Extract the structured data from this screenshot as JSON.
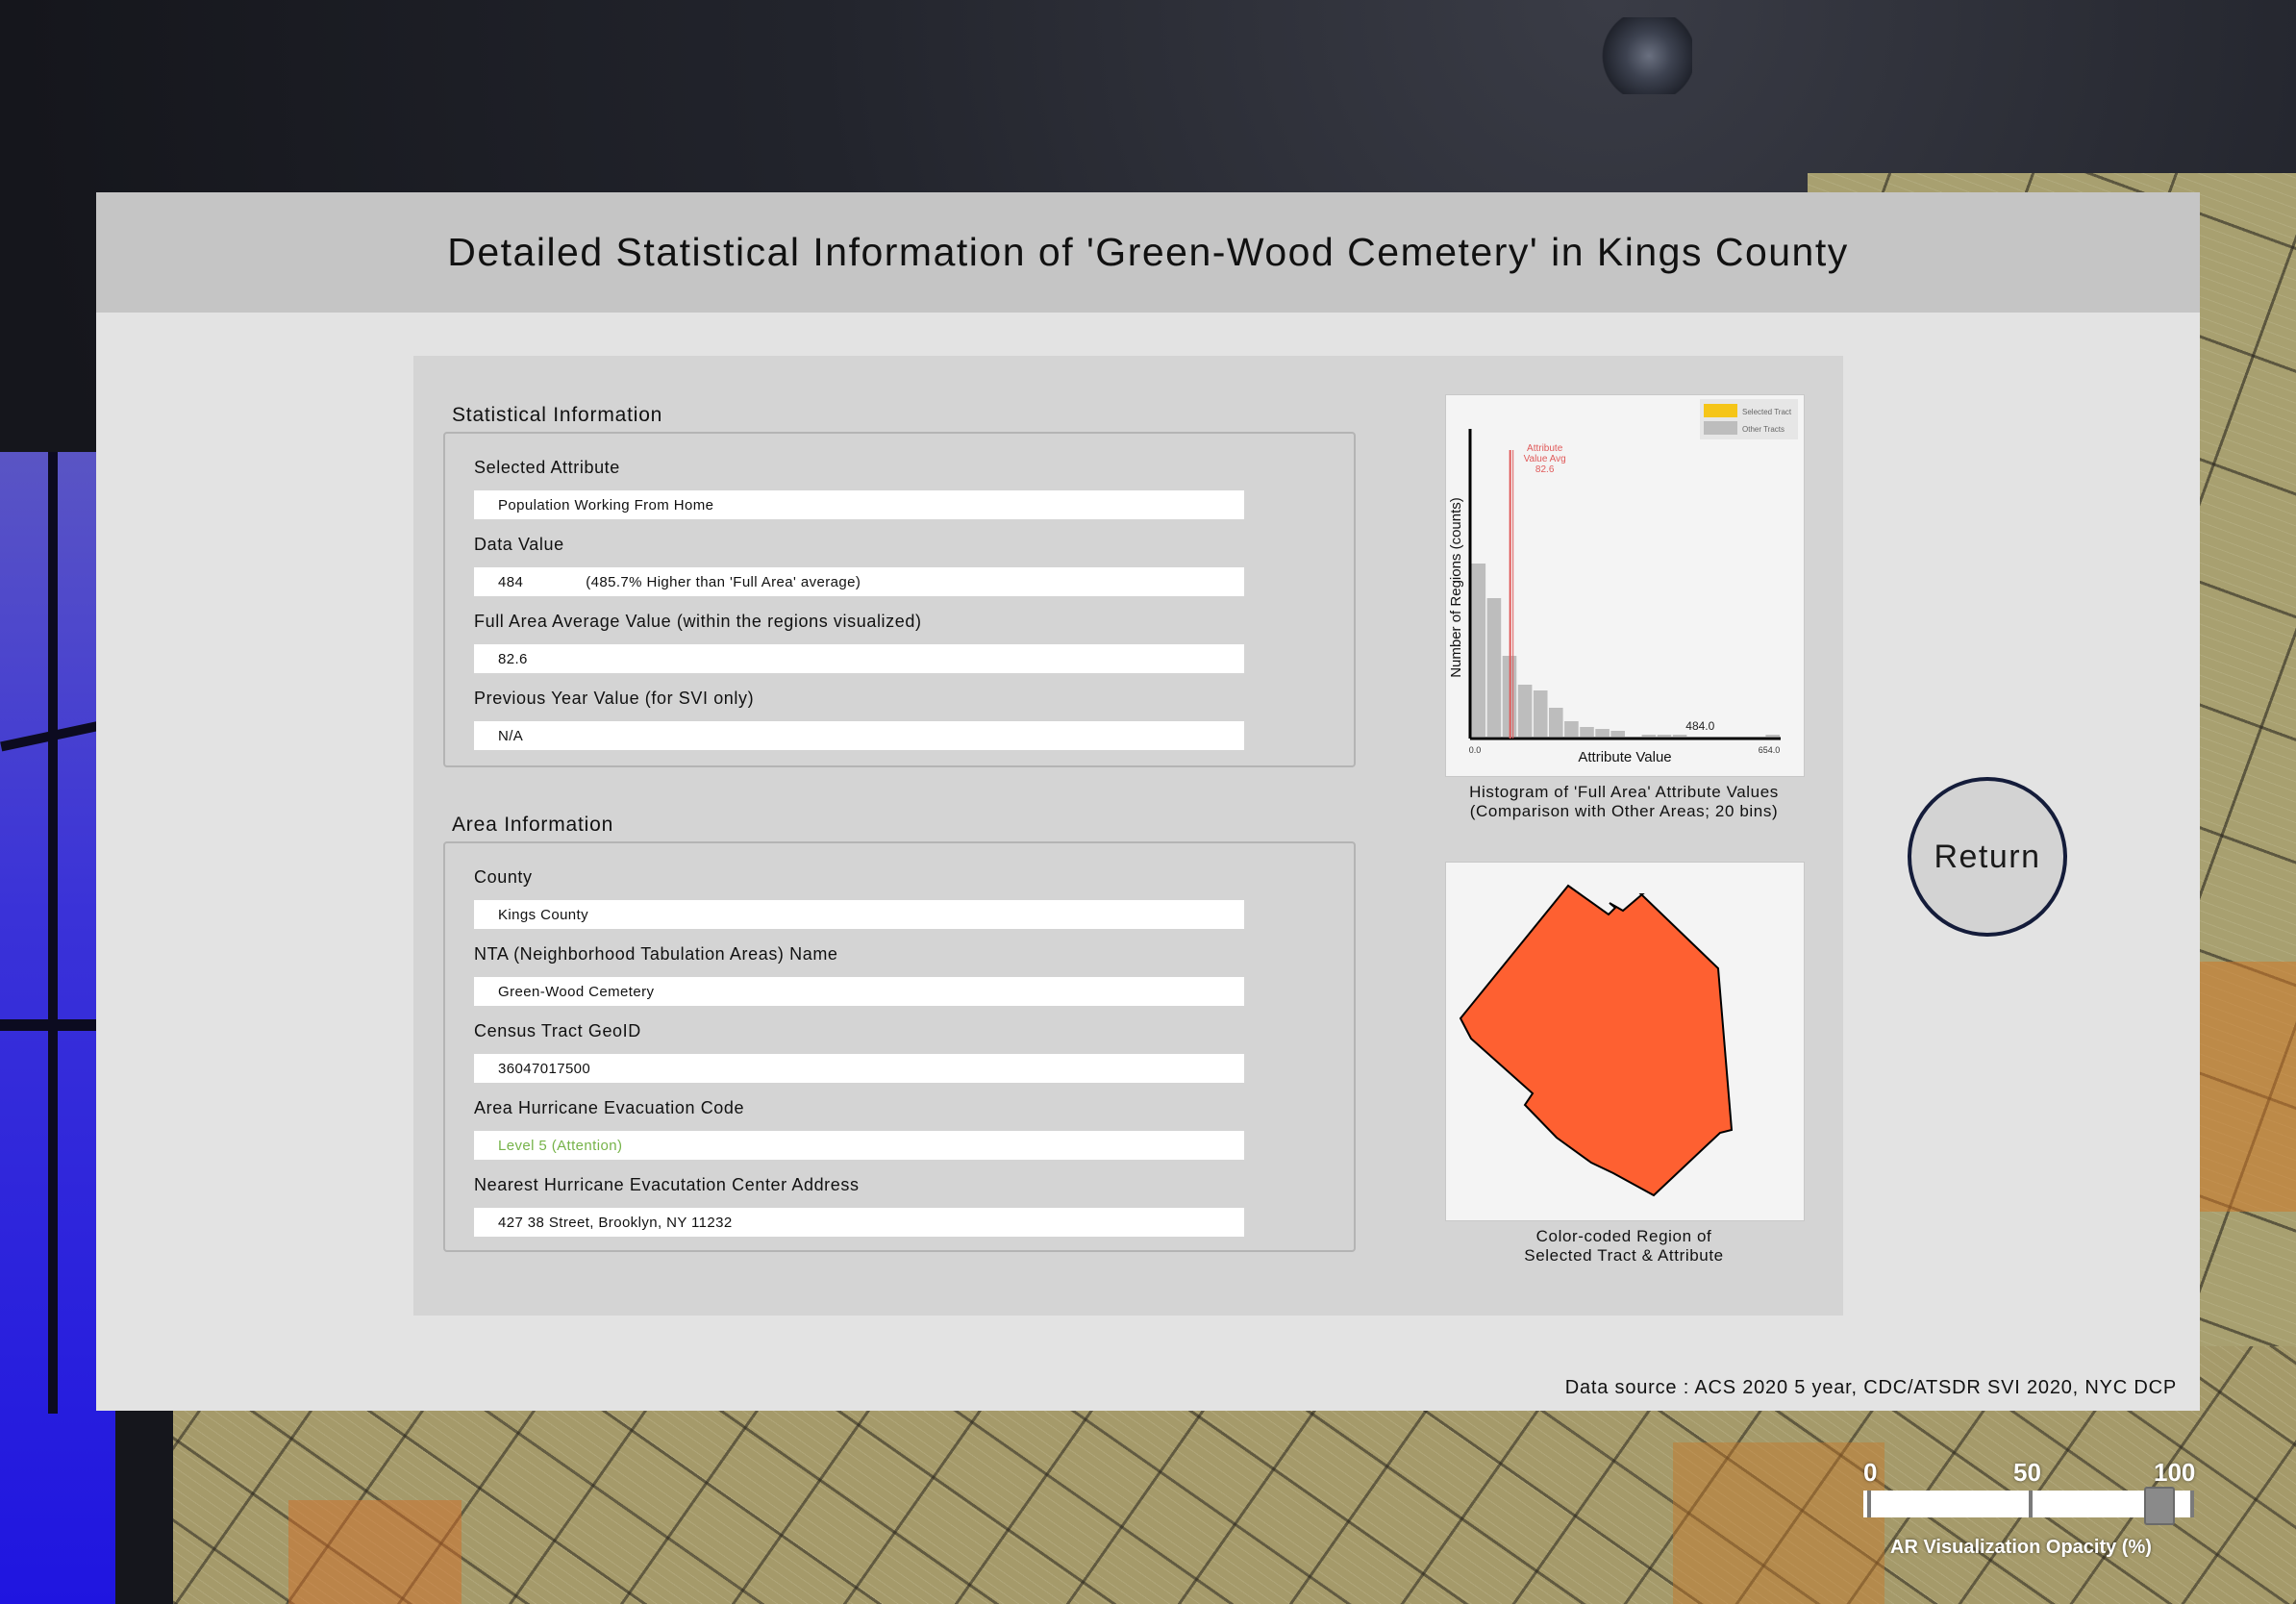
{
  "title": "Detailed Statistical Information of 'Green-Wood Cemetery' in Kings County",
  "statistical_info": {
    "section_title": "Statistical Information",
    "fields": [
      {
        "label": "Selected Attribute",
        "value": "Population Working From Home"
      },
      {
        "label": "Data Value",
        "value": "484",
        "comparison": "(485.7% Higher than 'Full Area' average)"
      },
      {
        "label": "Full Area Average Value (within the regions visualized)",
        "value": "82.6"
      },
      {
        "label": "Previous Year Value (for SVI only)",
        "value": "N/A"
      }
    ]
  },
  "area_info": {
    "section_title": "Area Information",
    "fields": [
      {
        "label": "County",
        "value": "Kings County"
      },
      {
        "label": "NTA (Neighborhood Tabulation Areas) Name",
        "value": "Green-Wood Cemetery"
      },
      {
        "label": "Census Tract GeoID",
        "value": "36047017500"
      },
      {
        "label": "Area Hurricane Evacuation Code",
        "value": "Level 5 (Attention)",
        "value_color": "#76b349"
      },
      {
        "label": "Nearest Hurricane Evacutation Center Address",
        "value": "427 38 Street, Brooklyn, NY 11232"
      }
    ]
  },
  "histogram": {
    "caption_line1": "Histogram of 'Full Area' Attribute Values",
    "caption_line2": "(Comparison with Other Areas; 20 bins)"
  },
  "chart_data": {
    "type": "bar",
    "xlabel": "Attribute Value",
    "ylabel": "Number of Regions (counts)",
    "x_min_label": "0.0",
    "x_max_label": "654.0",
    "xlim": [
      0,
      654
    ],
    "bins": 20,
    "series": [
      {
        "name": "Selected Tract",
        "color": "#f5c518"
      },
      {
        "name": "Other Tracts",
        "color": "#bdbdbd",
        "values": [
          90,
          72,
          42,
          27,
          24,
          15,
          8,
          5,
          4,
          3,
          0,
          1,
          1,
          1,
          0,
          0,
          0,
          0,
          0,
          1
        ]
      }
    ],
    "avg_line": {
      "value": 82.6,
      "label_lines": [
        "Attribute",
        "Value Avg",
        "82.6"
      ],
      "color": "#e05a5a"
    },
    "selected_marker": {
      "value": 484.0,
      "label": "484.0"
    }
  },
  "region": {
    "caption_line1": "Color-coded Region of",
    "caption_line2": "Selected Tract & Attribute",
    "fill_color": "#fe6031"
  },
  "return_label": "Return",
  "data_source": "Data source : ACS 2020 5 year, CDC/ATSDR SVI 2020, NYC DCP",
  "opacity_slider": {
    "ticks": [
      "0",
      "50",
      "100"
    ],
    "value": 90,
    "caption": "AR Visualization Opacity (%)"
  }
}
